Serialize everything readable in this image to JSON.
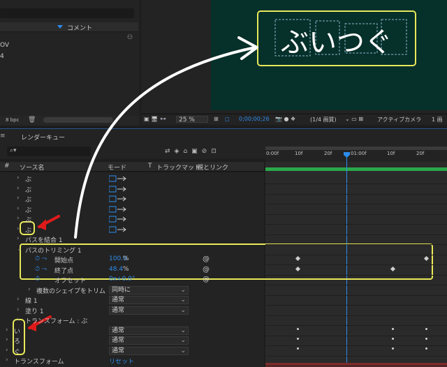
{
  "project": {
    "column_comment": "コメント",
    "lines": [
      "OV",
      "4"
    ],
    "bpc": "8 bpc"
  },
  "canvas": {
    "text": "ぶいつぐ"
  },
  "viewer_bar": {
    "zoom": "25 %",
    "timecode": "0;00;00;26",
    "resolution": "(1/4 画質)",
    "camera": "アクティブカメラ",
    "views": "1 画"
  },
  "timeline": {
    "tab": "レンダーキュー",
    "search_placeholder": "",
    "columns": {
      "hash": "#",
      "source": "ソース名",
      "mode": "モード",
      "t": "T",
      "trackmatte": "トラックマット",
      "parent": "親とリンク"
    },
    "ruler": [
      "0:00f",
      "10f",
      "20f",
      "01:00f",
      "10f",
      "20f"
    ],
    "rows": [
      {
        "indent": 1,
        "label": "ぶ",
        "has_mode": true
      },
      {
        "indent": 1,
        "label": "ぶ",
        "has_mode": true
      },
      {
        "indent": 1,
        "label": "ぶ",
        "has_mode": true
      },
      {
        "indent": 1,
        "label": "ぶ",
        "has_mode": true
      },
      {
        "indent": 1,
        "label": "ぶ",
        "has_mode": true
      },
      {
        "indent": 1,
        "label": "ぶ",
        "has_mode": true
      },
      {
        "indent": 1,
        "label": "パスを結合 1"
      },
      {
        "indent": 1,
        "label": "パスのトリミング 1"
      },
      {
        "indent": 2,
        "label": "開始点",
        "value": "100.0",
        "unit": "%"
      },
      {
        "indent": 2,
        "label": "終了点",
        "value": "48.4",
        "unit": "%"
      },
      {
        "indent": 2,
        "label": "オフセット",
        "value": "0x+0.0°"
      },
      {
        "indent": 2,
        "label": "複数のシェイプをトリム",
        "dropdown": "同時に"
      },
      {
        "indent": 1,
        "label": "線 1",
        "dropdown": "通常"
      },
      {
        "indent": 1,
        "label": "塗り 1",
        "dropdown": "通常"
      },
      {
        "indent": 1,
        "label": "トランスフォーム : ぶ"
      },
      {
        "indent": 0,
        "label": "い",
        "dropdown": "通常"
      },
      {
        "indent": 0,
        "label": "ろ",
        "dropdown": "通常"
      },
      {
        "indent": 0,
        "label": "ぐ",
        "dropdown": "通常"
      },
      {
        "indent": 0,
        "label": "トランスフォーム",
        "value": "リセット"
      }
    ]
  }
}
